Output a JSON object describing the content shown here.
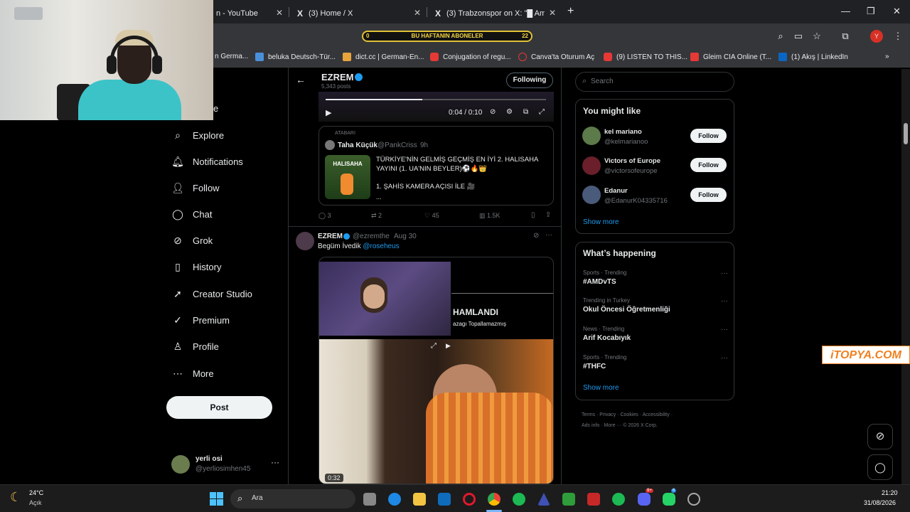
{
  "browser": {
    "tabs": [
      {
        "label": "n - YouTube",
        "logo": ""
      },
      {
        "label": "(3) Home / X",
        "logo": "X"
      },
      {
        "label": "(3) Trabzonspor on X: \"█ Ame",
        "logo": "X"
      }
    ],
    "new_tab": "+",
    "subscriber_bar": {
      "left": "0",
      "text": "BU HAFTANIN ABONELER",
      "right": "22"
    },
    "profile_initial": "Y",
    "bookmarks": [
      {
        "label": "n Germa...",
        "color": "#4a4a4a"
      },
      {
        "label": "beluka Deutsch-Tür...",
        "color": "#4a90d9"
      },
      {
        "label": "dict.cc | German-En...",
        "color": "#e8a33d"
      },
      {
        "label": "Conjugation of regu...",
        "color": "#e53935"
      },
      {
        "label": "Canva'ta Oturum Aç",
        "color": "#e53935"
      },
      {
        "label": "(9) LISTEN TO THIS...",
        "color": "#e53935"
      },
      {
        "label": "Gleim CIA Online (T...",
        "color": "#e53935"
      },
      {
        "label": "(1) Akış | LinkedIn",
        "color": "#0a66c2"
      }
    ]
  },
  "nav": {
    "partial_home": "e",
    "items": [
      "Explore",
      "Notifications",
      "Follow",
      "Chat",
      "Grok",
      "History",
      "Creator Studio",
      "Premium",
      "Profile",
      "More"
    ],
    "post": "Post",
    "account": {
      "name": "yerli osi",
      "handle": "@yerliosimhen45"
    }
  },
  "header": {
    "name": "EZREM",
    "posts": "5,343 posts",
    "following": "Following"
  },
  "video": {
    "time": "0:04 / 0:10"
  },
  "quote": {
    "label": "ATABARI",
    "author": "Taha Küçük",
    "handle": "@PankCriss",
    "age": "9h",
    "line1": "TÜRKİYE'NİN GELMİŞ GEÇMİŞ EN İYİ 2. HALISAHA YAYINI (1. UA'NIN BEYLER)⚽🔥👑",
    "line2": "1. ŞAHİS KAMERA AÇISI İLE 🎥",
    "line3": "...",
    "thumb_text": "HALISAHA"
  },
  "stats": {
    "replies": "3",
    "reposts": "2",
    "likes": "45",
    "views": "1.5K"
  },
  "tweet2": {
    "name": "EZREM",
    "handle": "@ezremthe",
    "date": "Aug 30",
    "text": "Begüm İvedik",
    "mention": "@roseheus",
    "overlay1": "HAMLANDI",
    "overlay2": "azagı Topallamazmış",
    "duration": "0:32"
  },
  "search": {
    "placeholder": "Search"
  },
  "suggestions": {
    "title": "You might like",
    "users": [
      {
        "name": "kel mariano",
        "handle": "@kelmarianoo",
        "follow": "Follow"
      },
      {
        "name": "Victors of Europe",
        "handle": "@victorsofeurope",
        "follow": "Follow"
      },
      {
        "name": "Edanur",
        "handle": "@EdanurK04335716",
        "follow": "Follow"
      }
    ],
    "show_more": "Show more"
  },
  "happening": {
    "title": "What’s happening",
    "trends": [
      {
        "context": "Sports · Trending",
        "topic": "#AMDvTS"
      },
      {
        "context": "Trending in Turkey",
        "topic": "Okul Öncesi Öğretmenliği"
      },
      {
        "context": "News · Trending",
        "topic": "Arif Kocabıyık"
      },
      {
        "context": "Sports · Trending",
        "topic": "#THFC"
      }
    ],
    "show_more": "Show more"
  },
  "footer": {
    "line1": [
      "Terms",
      "Privacy",
      "Cookies",
      "Accessibility"
    ],
    "line2": [
      "Ads info",
      "More ···",
      "© 2026 X Corp."
    ]
  },
  "watermark": "iTOPYA.COM",
  "taskbar": {
    "weather": {
      "temp": "24°C",
      "desc": "Açık"
    },
    "search": "Ara",
    "time": "21:20",
    "date": "31/08/2026",
    "badges": {
      "discord": "9+",
      "whatsapp": "6"
    }
  }
}
